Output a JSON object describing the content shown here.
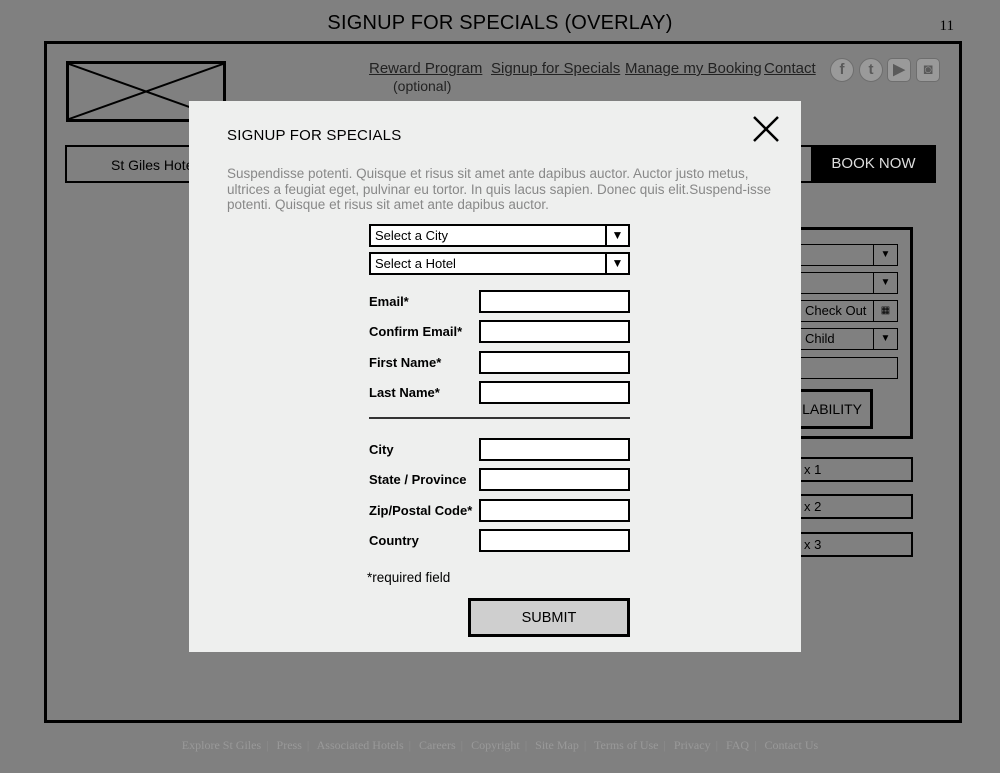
{
  "page": {
    "title": "SIGNUP FOR SPECIALS (OVERLAY)",
    "number": "11"
  },
  "header": {
    "nav": [
      {
        "label": "Reward Program",
        "sub": "(optional)"
      },
      {
        "label": "Signup for Specials"
      },
      {
        "label": "Manage my Booking"
      },
      {
        "label": "Contact"
      }
    ],
    "social": [
      {
        "name": "facebook-icon",
        "glyph": "f"
      },
      {
        "name": "twitter-icon",
        "glyph": "t"
      },
      {
        "name": "youtube-icon",
        "glyph": "▶"
      },
      {
        "name": "instagram-icon",
        "glyph": "◙"
      }
    ]
  },
  "hotel_bar": {
    "label": "St Giles Hote",
    "book_now": "BOOK NOW"
  },
  "widget": {
    "check_out": "Check Out",
    "child": "Child",
    "availability": "ILABILITY",
    "rooms": [
      "x 1",
      "x 2",
      "x 3"
    ]
  },
  "overlay": {
    "title": "SIGNUP FOR SPECIALS",
    "description": "Suspendisse potenti. Quisque et risus sit amet ante dapibus auctor. Auctor justo metus, ultrices a feugiat eget, pulvinar eu tortor. In quis lacus sapien. Donec quis elit.Suspend-isse potenti. Quisque et risus sit amet ante dapibus auctor.",
    "select_city": "Select a City",
    "select_hotel": "Select a Hotel",
    "fields": {
      "email": "Email*",
      "confirm_email": "Confirm Email*",
      "first_name": "First Name*",
      "last_name": "Last Name*",
      "city": "City",
      "state": "State / Province",
      "zip": "Zip/Postal Code*",
      "country": "Country"
    },
    "required_note": "*required field",
    "submit": "SUBMIT"
  },
  "footer": {
    "links": [
      "Explore St Giles",
      "Press",
      "Associated Hotels",
      "Careers",
      "Copyright",
      "Site Map",
      "Terms of Use",
      "Privacy",
      "FAQ",
      "Contact Us"
    ]
  }
}
